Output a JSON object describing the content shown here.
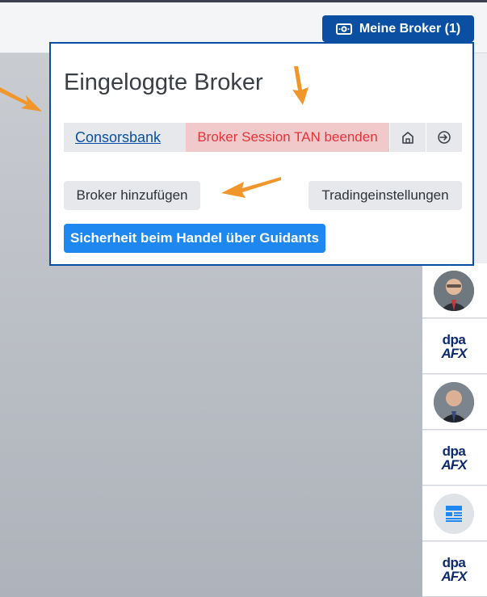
{
  "header": {
    "broker_button_label": "Meine Broker (1)"
  },
  "popup": {
    "title": "Eingeloggte Broker",
    "broker_name": "Consorsbank",
    "end_session_label": "Broker Session TAN beenden",
    "add_broker_label": "Broker hinzufügen",
    "trading_settings_label": "Tradingeinstellungen",
    "security_label": "Sicherheit beim Handel über Guidants"
  },
  "sidebar": {
    "items": [
      {
        "type": "avatar"
      },
      {
        "type": "dpa",
        "line1": "dpa",
        "line2": "AFX"
      },
      {
        "type": "avatar"
      },
      {
        "type": "dpa",
        "line1": "dpa",
        "line2": "AFX"
      },
      {
        "type": "news"
      },
      {
        "type": "dpa",
        "line1": "dpa",
        "line2": "AFX"
      }
    ]
  },
  "colors": {
    "accent": "#0b4fa3",
    "danger_text": "#e3343b",
    "danger_bg": "#f2c9cb",
    "primary_button": "#1e88f0",
    "arrow": "#f0962a"
  }
}
